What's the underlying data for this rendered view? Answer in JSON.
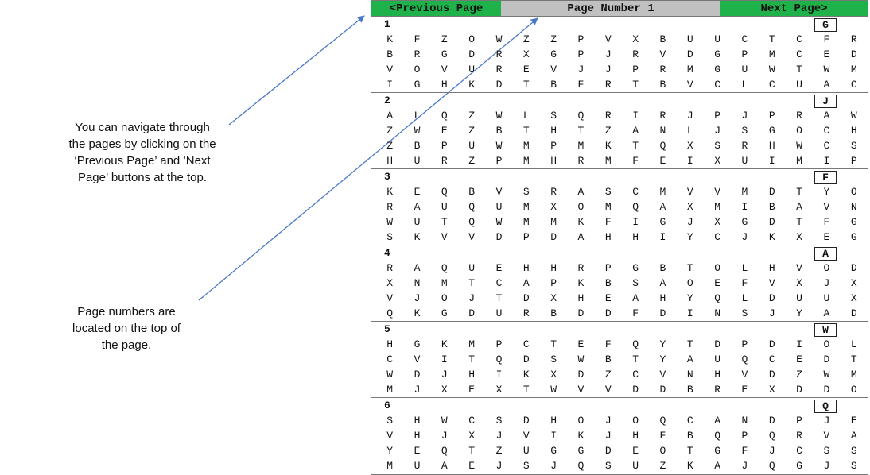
{
  "annotations": {
    "navigation_note": "You can navigate through\nthe pages by clicking on the\n‘Previous Page’ and ’Next\nPage’ buttons at the top.",
    "page_number_note": "Page numbers are\nlocated on the top of\nthe page."
  },
  "nav": {
    "previous_label": "<Previous Page",
    "page_label": "Page Number 1",
    "next_label": "Next Page>"
  },
  "colors": {
    "nav_button": "#1fb24a",
    "page_label_bg": "#c0c0c0",
    "arrow": "#4a78c8"
  },
  "blocks": [
    {
      "number": "1",
      "answer": "G",
      "rows": [
        [
          "K",
          "F",
          "Z",
          "O",
          "W",
          "Z",
          "Z",
          "P",
          "V",
          "X",
          "B",
          "U",
          "U",
          "C",
          "T",
          "C",
          "F",
          "R"
        ],
        [
          "B",
          "R",
          "G",
          "D",
          "R",
          "X",
          "G",
          "P",
          "J",
          "R",
          "V",
          "D",
          "G",
          "P",
          "M",
          "C",
          "E",
          "D"
        ],
        [
          "V",
          "O",
          "V",
          "U",
          "R",
          "E",
          "V",
          "J",
          "J",
          "P",
          "R",
          "M",
          "G",
          "U",
          "W",
          "T",
          "W",
          "M"
        ],
        [
          "I",
          "G",
          "H",
          "K",
          "D",
          "T",
          "B",
          "F",
          "R",
          "T",
          "B",
          "V",
          "C",
          "L",
          "C",
          "U",
          "A",
          "C"
        ]
      ]
    },
    {
      "number": "2",
      "answer": "J",
      "rows": [
        [
          "A",
          "L",
          "Q",
          "Z",
          "W",
          "L",
          "S",
          "Q",
          "R",
          "I",
          "R",
          "J",
          "P",
          "J",
          "P",
          "R",
          "A",
          "W"
        ],
        [
          "Z",
          "W",
          "E",
          "Z",
          "B",
          "T",
          "H",
          "T",
          "Z",
          "A",
          "N",
          "L",
          "J",
          "S",
          "G",
          "O",
          "C",
          "H"
        ],
        [
          "Z",
          "B",
          "P",
          "U",
          "W",
          "M",
          "P",
          "M",
          "K",
          "T",
          "Q",
          "X",
          "S",
          "R",
          "H",
          "W",
          "C",
          "S"
        ],
        [
          "H",
          "U",
          "R",
          "Z",
          "P",
          "M",
          "H",
          "R",
          "M",
          "F",
          "E",
          "I",
          "X",
          "U",
          "I",
          "M",
          "I",
          "P"
        ]
      ]
    },
    {
      "number": "3",
      "answer": "F",
      "rows": [
        [
          "K",
          "E",
          "Q",
          "B",
          "V",
          "S",
          "R",
          "A",
          "S",
          "C",
          "M",
          "V",
          "V",
          "M",
          "D",
          "T",
          "Y",
          "O"
        ],
        [
          "R",
          "A",
          "U",
          "Q",
          "U",
          "M",
          "X",
          "O",
          "M",
          "Q",
          "A",
          "X",
          "M",
          "I",
          "B",
          "A",
          "V",
          "N"
        ],
        [
          "W",
          "U",
          "T",
          "Q",
          "W",
          "M",
          "M",
          "K",
          "F",
          "I",
          "G",
          "J",
          "X",
          "G",
          "D",
          "T",
          "F",
          "G"
        ],
        [
          "S",
          "K",
          "V",
          "V",
          "D",
          "P",
          "D",
          "A",
          "H",
          "H",
          "I",
          "Y",
          "C",
          "J",
          "K",
          "X",
          "E",
          "G"
        ]
      ]
    },
    {
      "number": "4",
      "answer": "A",
      "rows": [
        [
          "R",
          "A",
          "Q",
          "U",
          "E",
          "H",
          "H",
          "R",
          "P",
          "G",
          "B",
          "T",
          "O",
          "L",
          "H",
          "V",
          "O",
          "D"
        ],
        [
          "X",
          "N",
          "M",
          "T",
          "C",
          "A",
          "P",
          "K",
          "B",
          "S",
          "A",
          "O",
          "E",
          "F",
          "V",
          "X",
          "J",
          "X"
        ],
        [
          "V",
          "J",
          "O",
          "J",
          "T",
          "D",
          "X",
          "H",
          "E",
          "A",
          "H",
          "Y",
          "Q",
          "L",
          "D",
          "U",
          "U",
          "X"
        ],
        [
          "Q",
          "K",
          "G",
          "D",
          "U",
          "R",
          "B",
          "D",
          "D",
          "F",
          "D",
          "I",
          "N",
          "S",
          "J",
          "Y",
          "A",
          "D"
        ]
      ]
    },
    {
      "number": "5",
      "answer": "W",
      "rows": [
        [
          "H",
          "G",
          "K",
          "M",
          "P",
          "C",
          "T",
          "E",
          "F",
          "Q",
          "Y",
          "T",
          "D",
          "P",
          "D",
          "I",
          "O",
          "L"
        ],
        [
          "C",
          "V",
          "I",
          "T",
          "Q",
          "D",
          "S",
          "W",
          "B",
          "T",
          "Y",
          "A",
          "U",
          "Q",
          "C",
          "E",
          "D",
          "T"
        ],
        [
          "W",
          "D",
          "J",
          "H",
          "I",
          "K",
          "X",
          "D",
          "Z",
          "C",
          "V",
          "N",
          "H",
          "V",
          "D",
          "Z",
          "W",
          "M"
        ],
        [
          "M",
          "J",
          "X",
          "E",
          "X",
          "T",
          "W",
          "V",
          "V",
          "D",
          "D",
          "B",
          "R",
          "E",
          "X",
          "D",
          "D",
          "O"
        ]
      ]
    },
    {
      "number": "6",
      "answer": "Q",
      "rows": [
        [
          "S",
          "H",
          "W",
          "C",
          "S",
          "D",
          "H",
          "O",
          "J",
          "O",
          "Q",
          "C",
          "A",
          "N",
          "D",
          "P",
          "J",
          "E"
        ],
        [
          "V",
          "H",
          "J",
          "X",
          "J",
          "V",
          "I",
          "K",
          "J",
          "H",
          "F",
          "B",
          "Q",
          "P",
          "Q",
          "R",
          "V",
          "A"
        ],
        [
          "Y",
          "E",
          "Q",
          "T",
          "Z",
          "U",
          "G",
          "G",
          "D",
          "E",
          "O",
          "T",
          "G",
          "F",
          "J",
          "C",
          "S",
          "S"
        ],
        [
          "M",
          "U",
          "A",
          "E",
          "J",
          "S",
          "J",
          "Q",
          "S",
          "U",
          "Z",
          "K",
          "A",
          "J",
          "Q",
          "G",
          "J",
          "S"
        ]
      ]
    }
  ]
}
